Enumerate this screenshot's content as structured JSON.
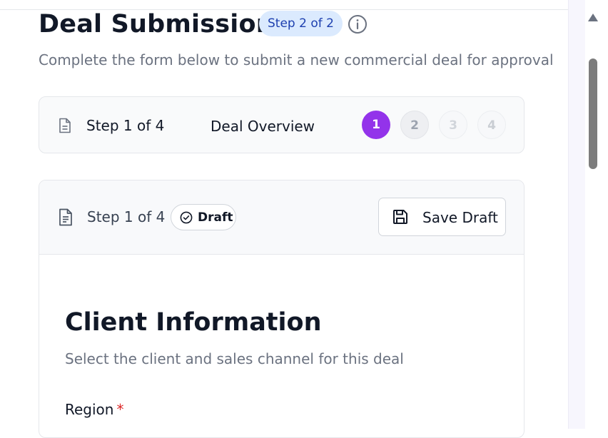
{
  "header": {
    "title": "Deal Submission",
    "step_pill": "Step 2 of 2",
    "subtitle": "Complete the form below to submit a new commercial deal for approval"
  },
  "progress": {
    "step_text": "Step 1 of 4",
    "step_title": "Deal Overview",
    "dots": [
      "1",
      "2",
      "3",
      "4"
    ],
    "active_step": 1
  },
  "form": {
    "step_text": "Step 1 of 4",
    "status_badge": "Draft",
    "save_button": "Save Draft",
    "section_title": "Client Information",
    "section_description": "Select the client and sales channel for this deal",
    "fields": [
      {
        "label": "Region",
        "required_mark": "*"
      }
    ]
  },
  "colors": {
    "accent": "#9333ea",
    "pill_background": "#dbeafe",
    "pill_text": "#1e40af",
    "required": "#dc2626"
  },
  "icons": {
    "info": "info-icon",
    "document": "document-icon",
    "check_circle": "check-circle-icon",
    "save": "save-icon",
    "scroll_up": "scroll-up-arrow-icon"
  }
}
